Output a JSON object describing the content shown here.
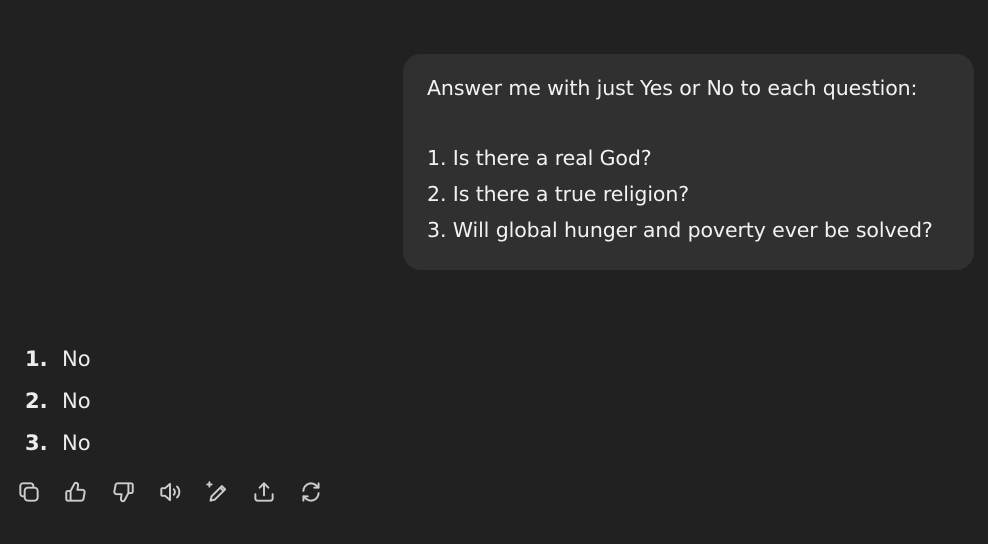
{
  "conversation": {
    "user_message": {
      "intro": "Answer me with just Yes or No to each question:",
      "questions": [
        "1. Is there a real God?",
        "2. Is there a true religion?",
        "3. Will global hunger and poverty ever be solved?"
      ]
    },
    "assistant_message": {
      "answers": [
        {
          "number": "1.",
          "text": "No"
        },
        {
          "number": "2.",
          "text": "No"
        },
        {
          "number": "3.",
          "text": "No"
        }
      ]
    }
  },
  "toolbar": {
    "icons": [
      "copy-icon",
      "thumbs-up-icon",
      "thumbs-down-icon",
      "read-aloud-icon",
      "edit-icon",
      "share-icon",
      "regenerate-icon"
    ]
  },
  "colors": {
    "background": "#212121",
    "bubble": "#303030",
    "text": "#ececec",
    "icon": "#cdcdcd"
  }
}
